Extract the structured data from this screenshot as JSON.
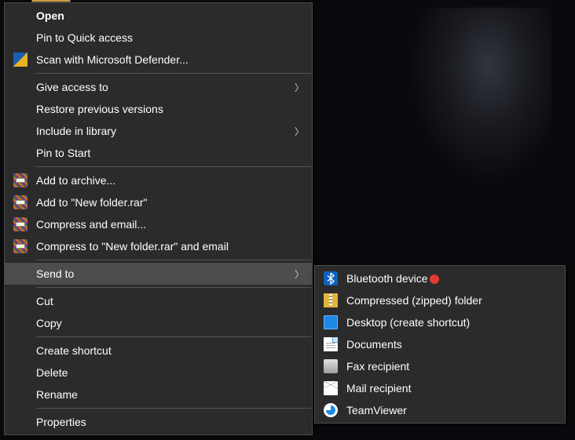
{
  "context_menu": {
    "open": "Open",
    "pin_quick_access": "Pin to Quick access",
    "scan_defender": "Scan with Microsoft Defender...",
    "give_access": "Give access to",
    "restore_prev": "Restore previous versions",
    "include_library": "Include in library",
    "pin_start": "Pin to Start",
    "add_archive": "Add to archive...",
    "add_rar": "Add to \"New folder.rar\"",
    "compress_email": "Compress and email...",
    "compress_rar_email": "Compress to \"New folder.rar\" and email",
    "send_to": "Send to",
    "cut": "Cut",
    "copy": "Copy",
    "create_shortcut": "Create shortcut",
    "delete": "Delete",
    "rename": "Rename",
    "properties": "Properties"
  },
  "send_to_submenu": {
    "bluetooth": "Bluetooth device",
    "zipped": "Compressed (zipped) folder",
    "desktop": "Desktop (create shortcut)",
    "documents": "Documents",
    "fax": "Fax recipient",
    "mail": "Mail recipient",
    "teamviewer": "TeamViewer"
  },
  "glyphs": {
    "submenu_arrow": "〉"
  }
}
